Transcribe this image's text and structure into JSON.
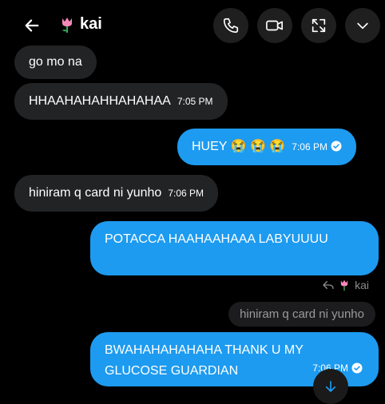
{
  "header": {
    "contact_name": "kai",
    "icons": [
      "back-arrow-icon",
      "tulip-emoji-icon",
      "phone-icon",
      "video-icon",
      "expand-icon",
      "chevron-down-icon"
    ]
  },
  "messages": [
    {
      "dir": "in",
      "text": "go mo na",
      "time": ""
    },
    {
      "dir": "in",
      "text": "HHAAHAHAHHAHAHAA",
      "time": "7:05 PM"
    },
    {
      "dir": "out",
      "text": "HUEY 😭 😭 😭",
      "time": "7:06 PM"
    },
    {
      "dir": "in",
      "text": "hiniram q card ni yunho",
      "time": "7:06 PM"
    },
    {
      "dir": "out",
      "text": "POTACCA HAAHAAHAAA LABYUUUU",
      "time": ""
    },
    {
      "dir": "out",
      "text": "BWAHAHAHAHAHA THANK U MY GLUCOSE GUARDIAN",
      "time": "7:06 PM"
    }
  ],
  "reply": {
    "label": "kai",
    "quoted_text": "hiniram q card ni yunho"
  },
  "colors": {
    "outgoing": "#1d9bf0",
    "incoming": "#222325",
    "background": "#000000"
  }
}
